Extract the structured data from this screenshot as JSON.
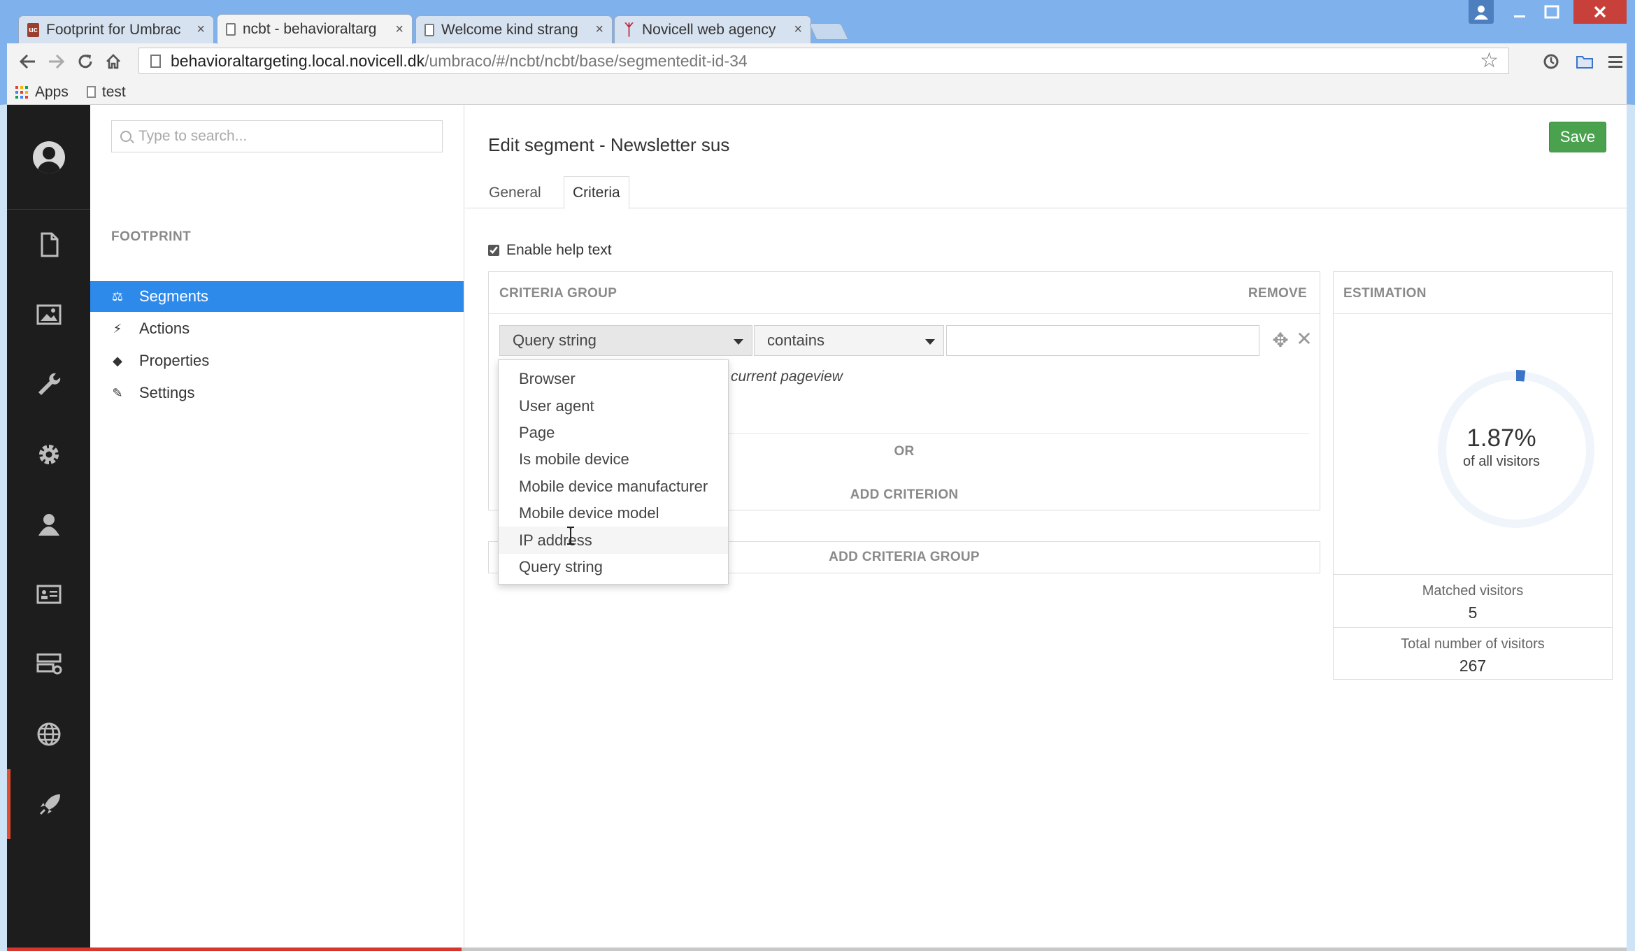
{
  "browser": {
    "tabs": [
      {
        "label": "Footprint for Umbrac",
        "favicon": "umbraco-icon",
        "active": false
      },
      {
        "label": "ncbt - behavioraltarg",
        "favicon": "page-icon",
        "active": true
      },
      {
        "label": "Welcome kind strang",
        "favicon": "page-icon",
        "active": false
      },
      {
        "label": "Novicell web agency",
        "favicon": "novicell-icon",
        "active": false
      }
    ],
    "tab_close": "×",
    "favicon_uc": "uc",
    "url_host": "behavioraltargeting.local.novicell.dk",
    "url_path": "/umbraco/#/ncbt/ncbt/base/segmentedit-id-34",
    "bookmarks": [
      {
        "label": "Apps",
        "icon": "apps-grid-icon"
      },
      {
        "label": "test",
        "icon": "page-icon"
      }
    ]
  },
  "tree": {
    "search_placeholder": "Type to search...",
    "section_title": "FOOTPRINT",
    "items": [
      {
        "label": "Segments",
        "icon": "scale-icon",
        "glyph": "⚖",
        "selected": true
      },
      {
        "label": "Actions",
        "icon": "bolt-icon",
        "glyph": "⚡",
        "selected": false
      },
      {
        "label": "Properties",
        "icon": "tag-icon",
        "glyph": "◆",
        "selected": false
      },
      {
        "label": "Settings",
        "icon": "wrench-icon",
        "glyph": "✎",
        "selected": false
      }
    ]
  },
  "editor": {
    "title": "Edit segment - Newsletter sus",
    "save_label": "Save",
    "tabs": [
      {
        "label": "General",
        "active": false
      },
      {
        "label": "Criteria",
        "active": true
      }
    ],
    "help_label": "Enable help text",
    "help_checked": true,
    "criteria_group": {
      "title": "CRITERIA GROUP",
      "remove_label": "REMOVE",
      "field_selected": "Query string",
      "operator_selected": "contains",
      "value": "",
      "help_text": "current pageview",
      "or_label": "OR",
      "add_criterion_label": "ADD CRITERION"
    },
    "add_group_label": "ADD CRITERIA GROUP",
    "field_options": [
      "Browser",
      "User agent",
      "Page",
      "Is mobile device",
      "Mobile device manufacturer",
      "Mobile device model",
      "IP address",
      "Query string"
    ],
    "hovered_option": "IP address"
  },
  "estimation": {
    "title": "ESTIMATION",
    "percent_value": 1.87,
    "percent": "1.87%",
    "subtitle": "of all visitors",
    "matched_label": "Matched visitors",
    "matched_value": "5",
    "total_label": "Total number of visitors",
    "total_value": "267",
    "ring_color": "#f0f5fc",
    "arc_color": "#3b73c7"
  },
  "colors": {
    "accent": "#2e8aea",
    "save_green": "#4aa24f",
    "nav_bg": "#1d1d1d",
    "active_nav_marker": "#e14d31"
  }
}
